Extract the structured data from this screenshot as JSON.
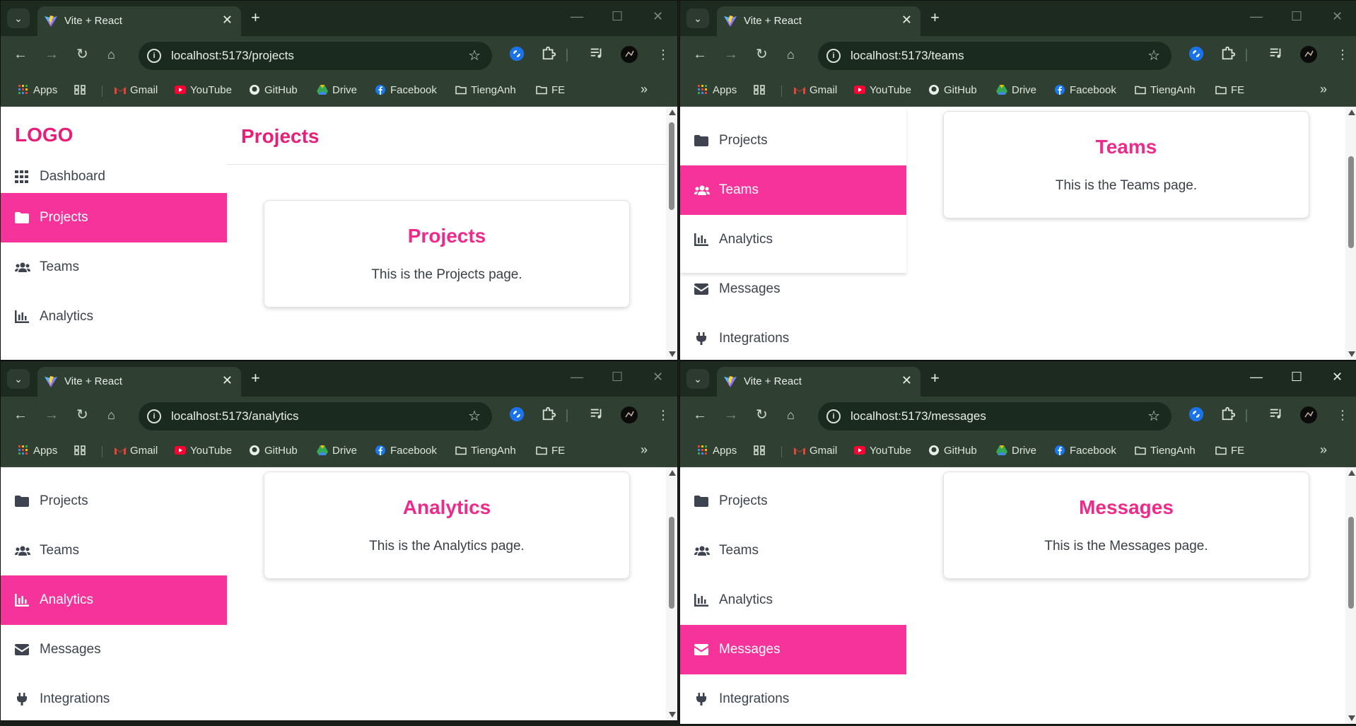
{
  "windows": [
    {
      "tab_title": "Vite + React",
      "url": "localhost:5173/projects",
      "page_title": "Projects",
      "logo": "LOGO",
      "nav_items": [
        "Dashboard",
        "Projects",
        "Teams",
        "Analytics"
      ],
      "active_nav": "Projects",
      "card_title": "Projects",
      "card_text": "This is the Projects page."
    },
    {
      "tab_title": "Vite + React",
      "url": "localhost:5173/teams",
      "nav_items": [
        "Projects",
        "Teams",
        "Analytics",
        "Messages",
        "Integrations"
      ],
      "active_nav": "Teams",
      "card_title": "Teams",
      "card_text": "This is the Teams page."
    },
    {
      "tab_title": "Vite + React",
      "url": "localhost:5173/analytics",
      "nav_items": [
        "Projects",
        "Teams",
        "Analytics",
        "Messages",
        "Integrations"
      ],
      "active_nav": "Analytics",
      "card_title": "Analytics",
      "card_text": "This is the Analytics page."
    },
    {
      "tab_title": "Vite + React",
      "url": "localhost:5173/messages",
      "nav_items": [
        "Projects",
        "Teams",
        "Analytics",
        "Messages",
        "Integrations"
      ],
      "active_nav": "Messages",
      "card_title": "Messages",
      "card_text": "This is the Messages page."
    }
  ],
  "bookmarks": [
    "Apps",
    "Gmail",
    "YouTube",
    "GitHub",
    "Drive",
    "Facebook",
    "TiengAnh",
    "FE"
  ],
  "icons": {
    "Dashboard": "grid-icon",
    "Projects": "folder-icon",
    "Teams": "users-icon",
    "Analytics": "bar-chart-icon",
    "Messages": "envelope-icon",
    "Integrations": "plug-icon"
  },
  "colors": {
    "accent": "#f6339a",
    "heading": "#e91e78",
    "chrome_dark": "#1c2a1f",
    "chrome_toolbar": "#2f3f32"
  }
}
